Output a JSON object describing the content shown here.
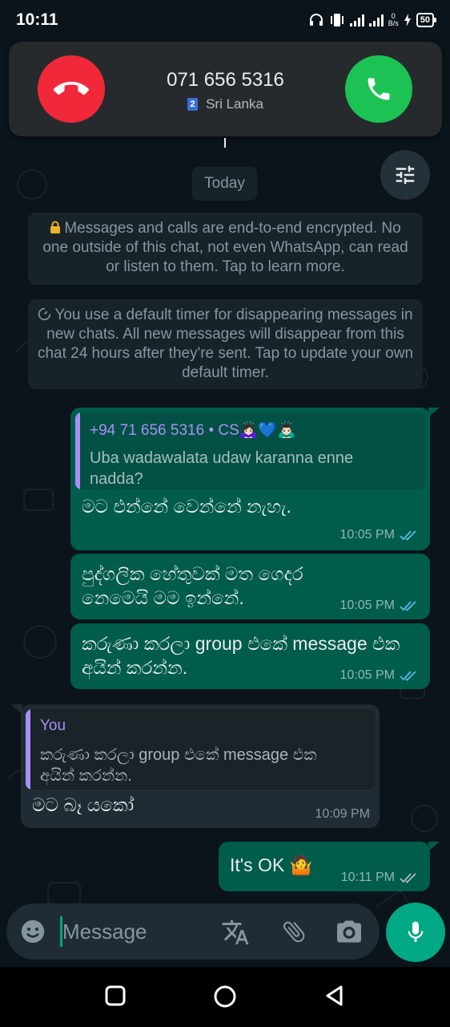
{
  "status_bar": {
    "time": "10:11",
    "net_speed_value": "0",
    "net_speed_unit": "B/s",
    "battery": "50"
  },
  "call": {
    "number": "071 656 5316",
    "sim_slot": "2",
    "country": "Sri Lanka",
    "decline_icon": "phone-hangup-icon",
    "accept_icon": "phone-icon"
  },
  "chat": {
    "date_chip": "Today",
    "filter_icon": "tune-icon",
    "encryption_notice": "Messages and calls are end-to-end encrypted. No one outside of this chat, not even WhatsApp, can read or listen to them. Tap to learn more.",
    "timer_notice": "You use a default timer for disappearing messages in new chats. All new messages will disappear from this chat 24 hours after they're sent. Tap to update your own default timer."
  },
  "messages": [
    {
      "direction": "out",
      "quote_author": "+94 71 656 5316 • CS🙇🏻‍♀️💙🙇🏻‍♂️",
      "quote_text": "Uba wadawalata udaw karanna enne nadda?",
      "text": "මට එන්නේ වෙන්නේ නැහැ.",
      "time": "10:05 PM",
      "status": "read"
    },
    {
      "direction": "out",
      "text": "පුද්ගලික හේතුවක් මත ගෙදර නෙමෙයි මම ඉන්නේ.",
      "time": "10:05 PM",
      "status": "read"
    },
    {
      "direction": "out",
      "text": "කරුණා කරලා group එකේ message එක අයින් කරන්න.",
      "time": "10:05 PM",
      "status": "read"
    },
    {
      "direction": "in",
      "quote_author": "You",
      "quote_text": "කරුණා කරලා group එකේ message එක අයින් කරන්න.",
      "text": "මට බෑ යකෝ",
      "time": "10:09 PM"
    },
    {
      "direction": "out",
      "text": "It's OK 🤷",
      "time": "10:11 PM",
      "status": "delivered"
    }
  ],
  "input": {
    "placeholder": "Message"
  },
  "colors": {
    "outgoing_bubble": "#005c4b",
    "incoming_bubble": "#202c33",
    "accent": "#00a884",
    "decline": "#f0283a",
    "accept": "#1dc254",
    "read_ticks": "#53bdeb"
  }
}
